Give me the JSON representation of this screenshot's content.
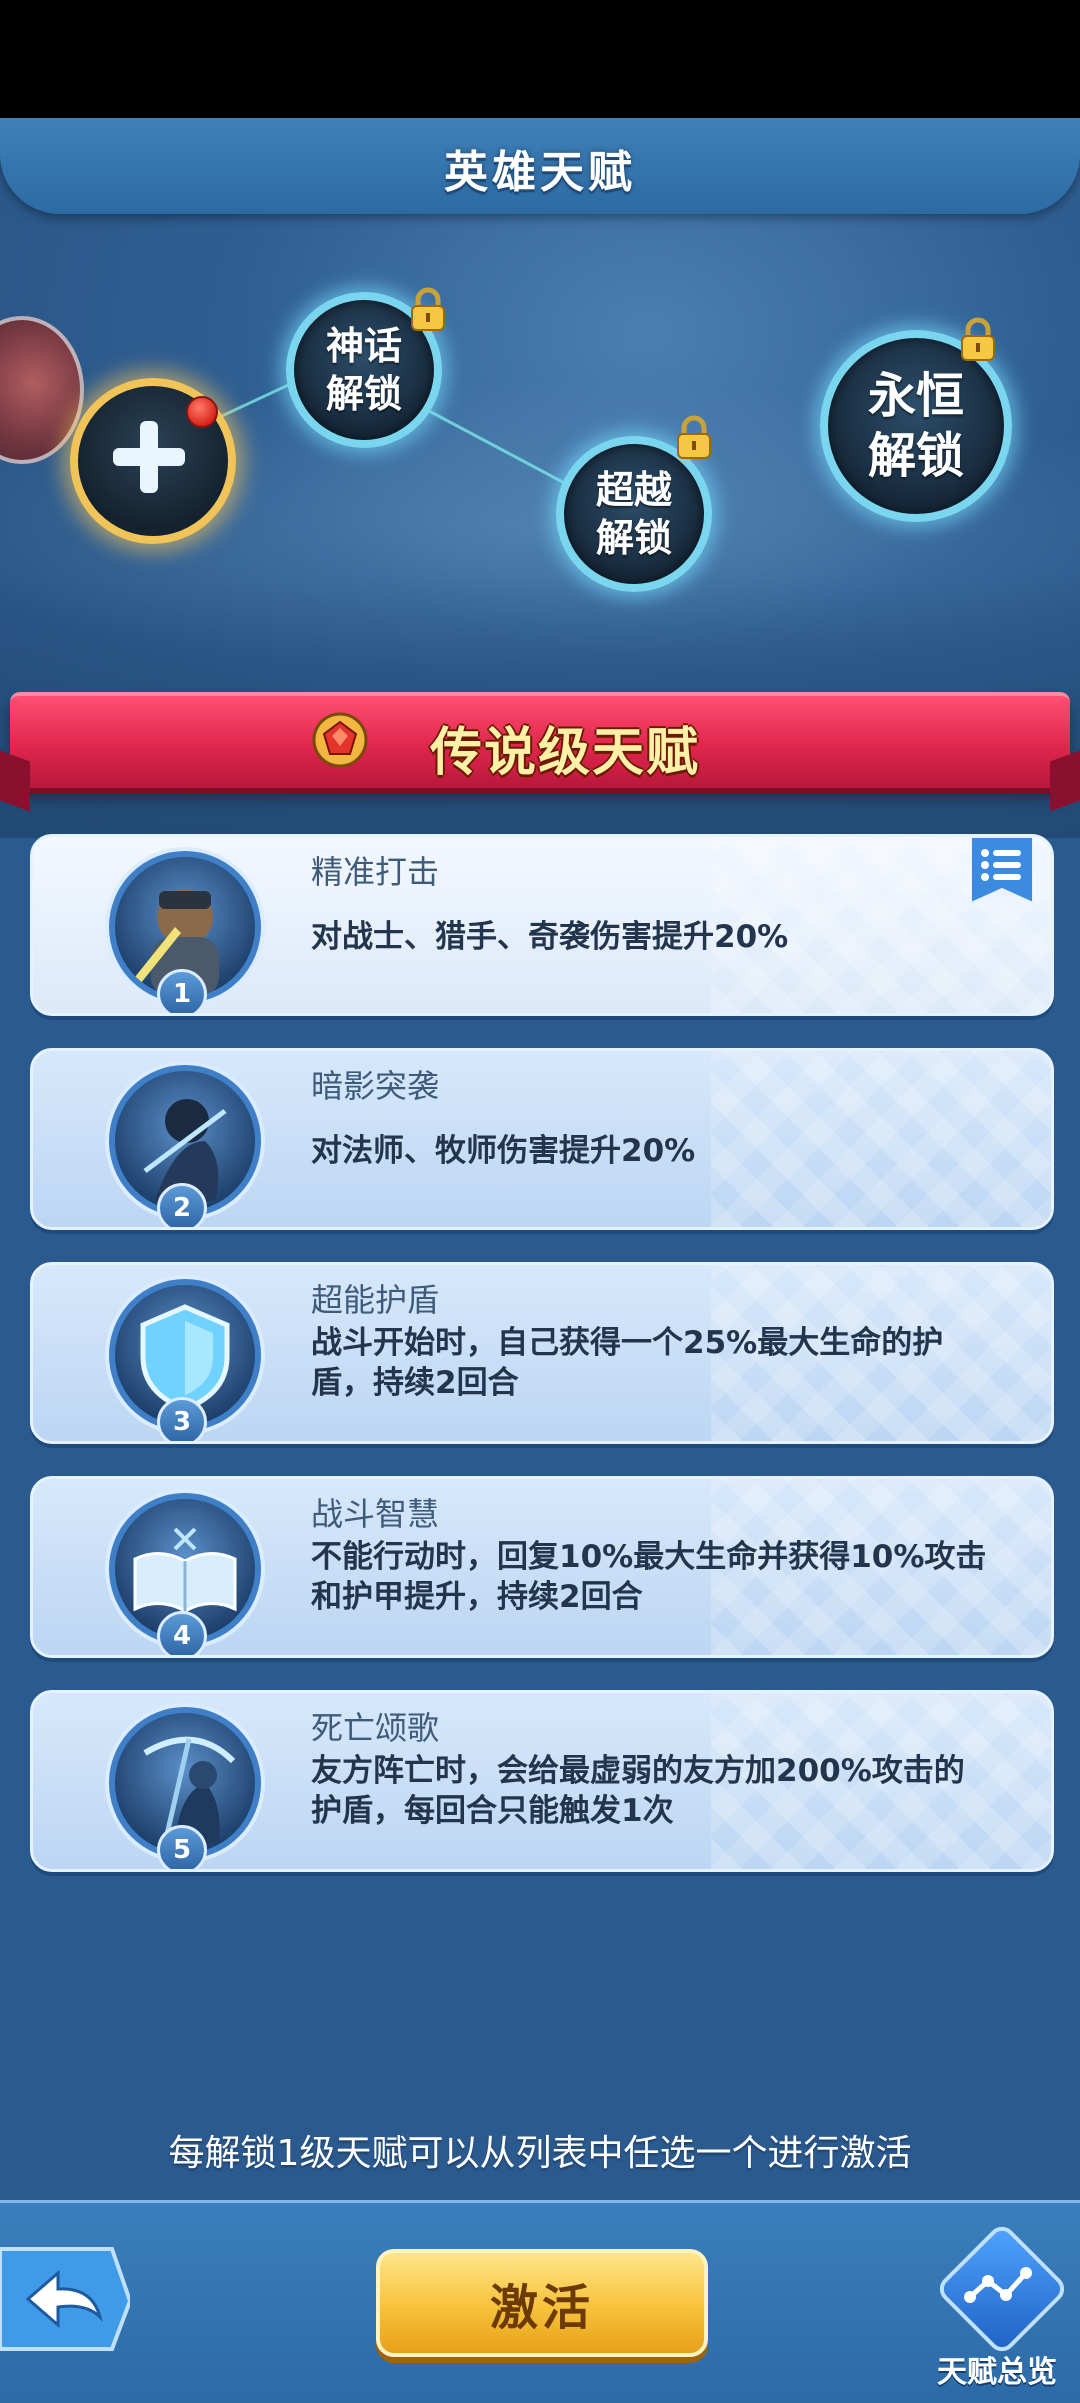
{
  "header": {
    "title": "英雄天赋"
  },
  "tree": {
    "nodes": [
      {
        "id": "mythic",
        "label": "神话\n解锁",
        "locked": true
      },
      {
        "id": "transcend",
        "label": "超越\n解锁",
        "locked": true
      },
      {
        "id": "eternal",
        "label": "永恒\n解锁",
        "locked": true
      }
    ]
  },
  "section": {
    "title": "传说级天赋"
  },
  "talents": [
    {
      "level": "1",
      "name": "精准打击",
      "desc": "对战士、猎手、奇袭伤害提升20%",
      "icon": "warrior-strike-icon"
    },
    {
      "level": "2",
      "name": "暗影突袭",
      "desc": "对法师、牧师伤害提升20%",
      "icon": "shadow-assault-icon"
    },
    {
      "level": "3",
      "name": "超能护盾",
      "desc": "战斗开始时，自己获得一个25%最大生命的护盾，持续2回合",
      "icon": "shield-icon"
    },
    {
      "level": "4",
      "name": "战斗智慧",
      "desc": "不能行动时，回复10%最大生命并获得10%攻击和护甲提升，持续2回合",
      "icon": "book-icon"
    },
    {
      "level": "5",
      "name": "死亡颂歌",
      "desc": "友方阵亡时，会给最虚弱的友方加200%攻击的护盾，每回合只能触发1次",
      "icon": "reaper-icon"
    }
  ],
  "footer": {
    "hint": "每解锁1级天赋可以从列表中任选一个进行激活",
    "activate_label": "激活",
    "overview_label": "天赋总览"
  },
  "colors": {
    "banner": "#e0264c",
    "button": "#f7c23b",
    "bg": "#2b5a8f"
  }
}
